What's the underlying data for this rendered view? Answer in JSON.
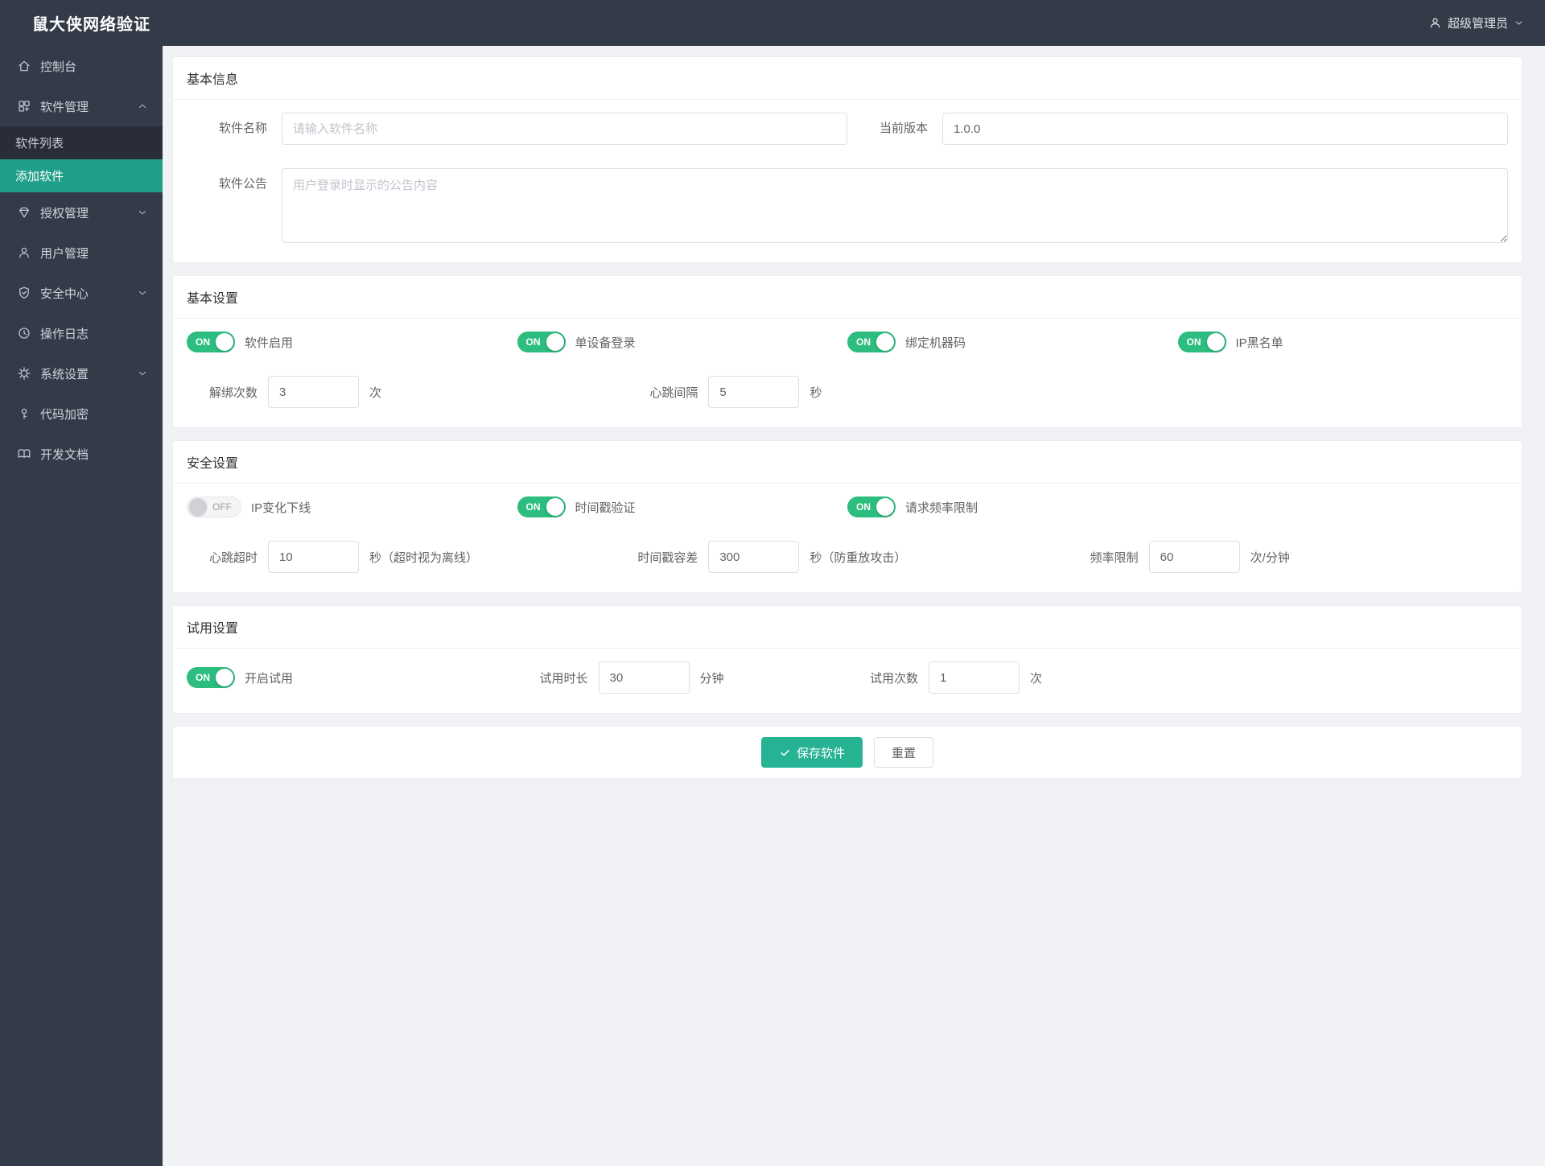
{
  "app": {
    "title": "鼠大侠网络验证"
  },
  "header": {
    "user_label": "超级管理员"
  },
  "colors": {
    "header_bg": "#343b48",
    "sidebar_submenu_bg": "#282d38",
    "accent_active_menu": "#1f9e8a",
    "toggle_on_green": "#2cbd7f",
    "save_button": "#26b394",
    "content_bg": "#f0f2f5"
  },
  "icons": {
    "sidebar": [
      "home-icon",
      "apps-icon",
      "gem-icon",
      "user-icon",
      "shield-check-icon",
      "clock-icon",
      "gear-icon",
      "key-icon",
      "book-icon"
    ],
    "header": [
      "user-icon",
      "chevron-down-icon"
    ],
    "save_button": "check-icon"
  },
  "sidebar": {
    "items": [
      {
        "label": "控制台"
      },
      {
        "label": "软件管理"
      },
      {
        "label": "软件列表"
      },
      {
        "label": "添加软件"
      },
      {
        "label": "授权管理"
      },
      {
        "label": "用户管理"
      },
      {
        "label": "安全中心"
      },
      {
        "label": "操作日志"
      },
      {
        "label": "系统设置"
      },
      {
        "label": "代码加密"
      },
      {
        "label": "开发文档"
      }
    ]
  },
  "sections": {
    "basic_info": {
      "title": "基本信息",
      "software_name": {
        "label": "软件名称",
        "placeholder": "请输入软件名称",
        "value": ""
      },
      "current_version": {
        "label": "当前版本",
        "value": "1.0.0"
      },
      "announcement": {
        "label": "软件公告",
        "placeholder": "用户登录时显示的公告内容",
        "value": ""
      }
    },
    "basic_settings": {
      "title": "基本设置",
      "toggles": [
        {
          "label": "软件启用",
          "state": "ON"
        },
        {
          "label": "单设备登录",
          "state": "ON"
        },
        {
          "label": "绑定机器码",
          "state": "ON"
        },
        {
          "label": "IP黑名单",
          "state": "ON"
        }
      ],
      "unbind_count": {
        "label": "解绑次数",
        "value": "3",
        "suffix": "次"
      },
      "heartbeat_interval": {
        "label": "心跳间隔",
        "value": "5",
        "suffix": "秒"
      }
    },
    "security_settings": {
      "title": "安全设置",
      "toggles": [
        {
          "label": "IP变化下线",
          "state": "OFF"
        },
        {
          "label": "时间戳验证",
          "state": "ON"
        },
        {
          "label": "请求频率限制",
          "state": "ON"
        }
      ],
      "heartbeat_timeout": {
        "label": "心跳超时",
        "value": "10",
        "suffix": "秒（超时视为离线）"
      },
      "timestamp_tolerance": {
        "label": "时间戳容差",
        "value": "300",
        "suffix": "秒（防重放攻击）"
      },
      "rate_limit": {
        "label": "频率限制",
        "value": "60",
        "suffix": "次/分钟"
      }
    },
    "trial_settings": {
      "title": "试用设置",
      "toggle": {
        "label": "开启试用",
        "state": "ON"
      },
      "trial_duration": {
        "label": "试用时长",
        "value": "30",
        "suffix": "分钟"
      },
      "trial_count": {
        "label": "试用次数",
        "value": "1",
        "suffix": "次"
      }
    },
    "actions": {
      "save": "保存软件",
      "reset": "重置"
    }
  }
}
